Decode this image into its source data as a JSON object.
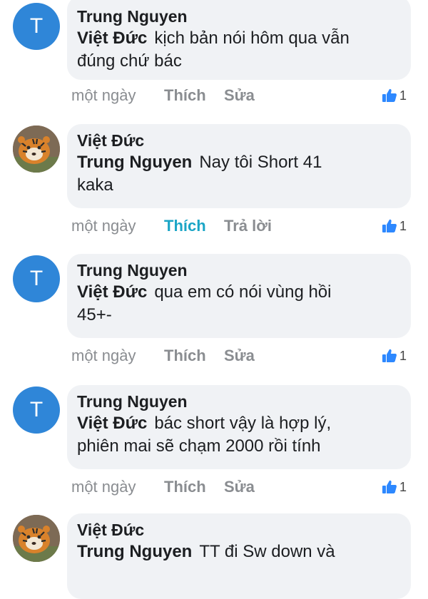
{
  "comments": [
    {
      "author": "Trung Nguyen",
      "avatar": {
        "type": "letter",
        "letter": "T"
      },
      "mention": "Việt Đức",
      "text_lines": [
        "kịch bản nói hôm qua vẫn",
        "đúng chứ bác"
      ],
      "time": "một ngày",
      "like_label": "Thích",
      "like_active": false,
      "second_action": "Sửa",
      "reaction_count": "1"
    },
    {
      "author": "Việt Đức",
      "avatar": {
        "type": "photo",
        "icon": "tiger-avatar-icon"
      },
      "mention": "Trung Nguyen",
      "text_lines": [
        "Nay tôi Short 41",
        "kaka"
      ],
      "time": "một ngày",
      "like_label": "Thích",
      "like_active": true,
      "second_action": "Trả lời",
      "reaction_count": "1"
    },
    {
      "author": "Trung Nguyen",
      "avatar": {
        "type": "letter",
        "letter": "T"
      },
      "mention": "Việt Đức",
      "text_lines": [
        "qua em có nói vùng hồi",
        "45+-"
      ],
      "time": "một ngày",
      "like_label": "Thích",
      "like_active": false,
      "second_action": "Sửa",
      "reaction_count": "1"
    },
    {
      "author": "Trung Nguyen",
      "avatar": {
        "type": "letter",
        "letter": "T"
      },
      "mention": "Việt Đức",
      "text_lines": [
        "bác short vậy là hợp lý,",
        "phiên mai sẽ chạm 2000 rồi tính"
      ],
      "time": "một ngày",
      "like_label": "Thích",
      "like_active": false,
      "second_action": "Sửa",
      "reaction_count": "1"
    },
    {
      "author": "Việt Đức",
      "avatar": {
        "type": "photo",
        "icon": "tiger-avatar-icon"
      },
      "mention": "Trung Nguyen",
      "text_lines": [
        "TT đi Sw down và"
      ],
      "time": "",
      "like_label": "",
      "like_active": false,
      "second_action": "",
      "reaction_count": ""
    }
  ],
  "colors": {
    "bubble_bg": "#f0f2f5",
    "avatar_blue": "#2f86d8",
    "liked_accent": "#1aa5c6",
    "thumb_blue": "#2d88ff",
    "muted_text": "#8a8d91"
  },
  "icons": {
    "like_reaction": "thumbs-up-icon",
    "photo_avatar": "tiger-avatar-icon"
  }
}
